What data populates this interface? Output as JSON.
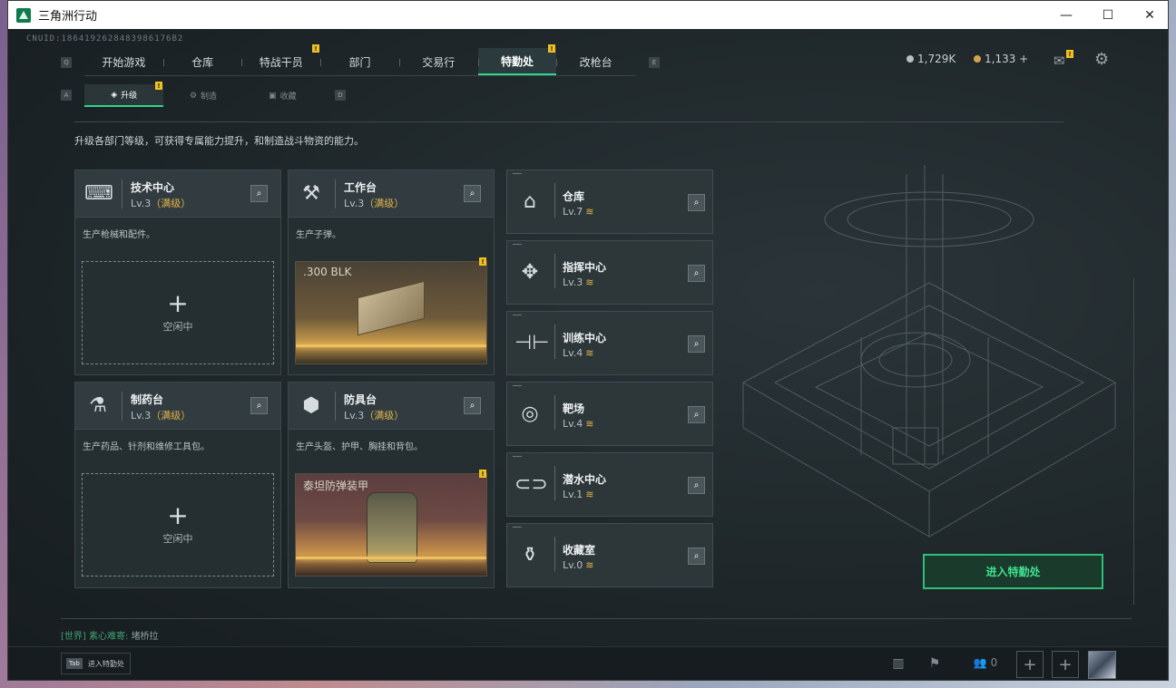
{
  "window": {
    "title": "三角洲行动",
    "minimize": "—",
    "maximize": "☐",
    "close": "✕"
  },
  "uid": "CNUID:1864192628483986176B2",
  "nav": {
    "key_left": "Q",
    "key_right": "E",
    "items": [
      {
        "label": "开始游戏",
        "active": false
      },
      {
        "label": "仓库",
        "active": false
      },
      {
        "label": "特战干员",
        "active": false,
        "badge": "!"
      },
      {
        "label": "部门",
        "active": false
      },
      {
        "label": "交易行",
        "active": false
      },
      {
        "label": "特勤处",
        "active": true,
        "badge": "!"
      },
      {
        "label": "改枪台",
        "active": false
      }
    ]
  },
  "subnav": {
    "key_left": "A",
    "key_right": "D",
    "items": [
      {
        "label": "升级",
        "active": true,
        "badge": "!",
        "icon": "upgrade-icon"
      },
      {
        "label": "制造",
        "active": false,
        "icon": "craft-icon"
      },
      {
        "label": "收藏",
        "active": false,
        "icon": "collection-icon"
      }
    ]
  },
  "currency": {
    "silver": "1,729K",
    "gold": "1,133 +"
  },
  "mail_badge": "!",
  "description": "升级各部门等级，可获得专属能力提升，和制造战斗物资的能力。",
  "left_cards": [
    {
      "name": "技术中心",
      "level": "Lv.3",
      "max": "（满级）",
      "desc": "生产枪械和配件。",
      "slot": "空闲中",
      "icon": "tech-center-icon"
    },
    {
      "name": "工作台",
      "level": "Lv.3",
      "max": "（满级）",
      "desc": "生产子弹。",
      "product": ".300 BLK",
      "icon": "workbench-icon"
    },
    {
      "name": "制药台",
      "level": "Lv.3",
      "max": "（满级）",
      "desc": "生产药品、针剂和维修工具包。",
      "slot": "空闲中",
      "icon": "pharmacy-icon"
    },
    {
      "name": "防具台",
      "level": "Lv.3",
      "max": "（满级）",
      "desc": "生产头盔、护甲、胸挂和背包。",
      "product": "泰坦防弹装甲",
      "icon": "armor-icon"
    }
  ],
  "slot_plus": "+",
  "right_cards": [
    {
      "name": "仓库",
      "level": "Lv.7",
      "icon": "warehouse-icon"
    },
    {
      "name": "指挥中心",
      "level": "Lv.3",
      "icon": "command-center-icon"
    },
    {
      "name": "训练中心",
      "level": "Lv.4",
      "icon": "training-center-icon"
    },
    {
      "name": "靶场",
      "level": "Lv.4",
      "icon": "shooting-range-icon"
    },
    {
      "name": "潜水中心",
      "level": "Lv.1",
      "icon": "diving-center-icon"
    },
    {
      "name": "收藏室",
      "level": "Lv.0",
      "icon": "collection-room-icon"
    }
  ],
  "upgrade_arrow": "≋",
  "enter_button": "进入特勤处",
  "chat": {
    "channel": "[世界]",
    "user": "素心难寄:",
    "message": "堵桥拉"
  },
  "bottom": {
    "tab_key": "Tab",
    "tab_label": "进入特勤处",
    "friends": "0"
  },
  "colors": {
    "accent": "#2fd58a",
    "max_level": "#e0b44a",
    "badge": "#f0c020"
  }
}
